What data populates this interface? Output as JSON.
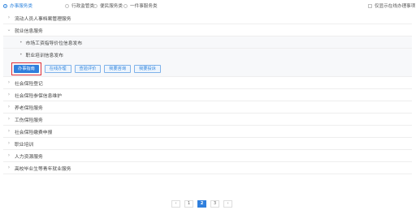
{
  "filters": {
    "options": [
      {
        "label": "办事服务类",
        "selected": true
      },
      {
        "label": "行政监管类",
        "selected": false
      },
      {
        "label": "便民服务类",
        "selected": false
      },
      {
        "label": "一件事服务类",
        "selected": false
      }
    ],
    "online_only_label": "仅显示在线办理事项"
  },
  "categories": [
    {
      "label": "流动人员人事档案管理服务",
      "expanded": false
    },
    {
      "label": "就业信息服务",
      "expanded": true
    },
    {
      "label": "社会保险登记",
      "expanded": false
    },
    {
      "label": "社会保险参保信息维护",
      "expanded": false
    },
    {
      "label": "养老保险服务",
      "expanded": false
    },
    {
      "label": "工伤保险服务",
      "expanded": false
    },
    {
      "label": "社会保险缴费申报",
      "expanded": false
    },
    {
      "label": "职业培训",
      "expanded": false
    },
    {
      "label": "人力资源服务",
      "expanded": false
    },
    {
      "label": "高校毕业生等青年就业服务",
      "expanded": false
    }
  ],
  "sub_items": [
    {
      "label": "市场工资指导价位信息发布"
    },
    {
      "label": "职业培训信息发布"
    }
  ],
  "actions": {
    "guide": "办事指南",
    "online": "在线办理",
    "rate": "查验评价",
    "consult": "我要咨询",
    "complain": "我要投诉"
  },
  "pagination": {
    "prev": "‹",
    "pages": [
      "1",
      "2",
      "3"
    ],
    "current": "2",
    "next": "›"
  },
  "colors": {
    "accent": "#2f7fdd",
    "highlight": "#e0303a"
  }
}
